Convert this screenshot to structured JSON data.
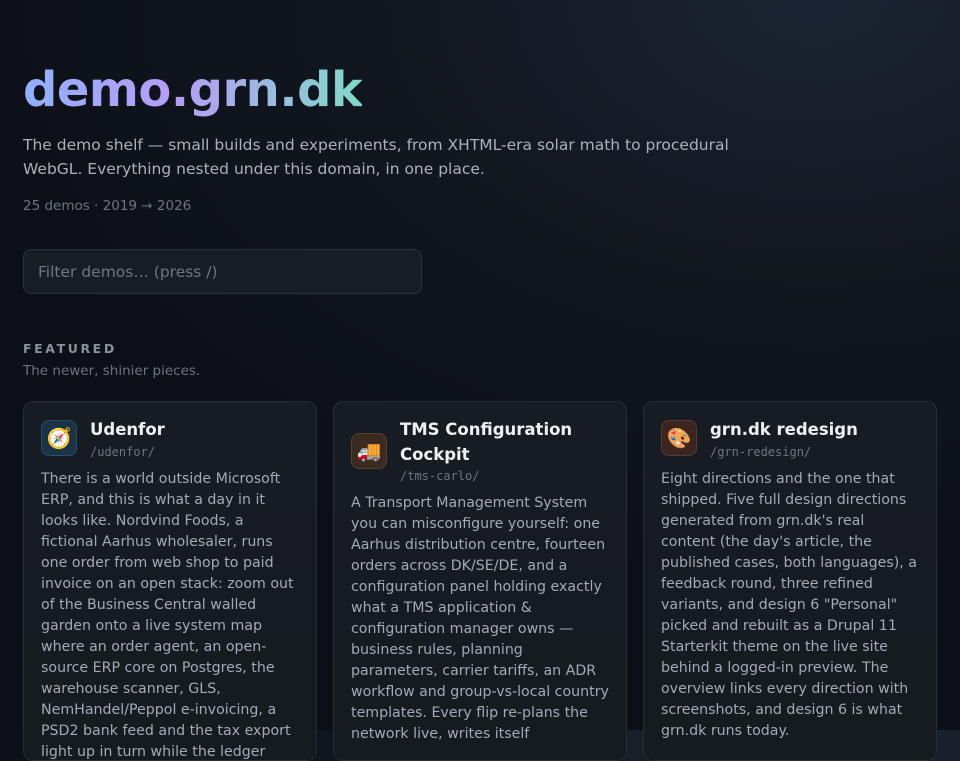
{
  "header": {
    "title": "demo.grn.dk",
    "intro": "The demo shelf — small builds and experiments, from XHTML-era solar math to procedural WebGL. Everything nested under this domain, in one place.",
    "meta": "25 demos · 2019 → 2026"
  },
  "filter": {
    "placeholder": "Filter demos… (press /)"
  },
  "featured": {
    "label": "FEATURED",
    "subtitle": "The newer, shinier pieces.",
    "cards": [
      {
        "icon": "compass-icon",
        "icon_glyph": "🧭",
        "title": "Udenfor",
        "path": "/udenfor/",
        "description": "There is a world outside Microsoft ERP, and this is what a day in it looks like. Nordvind Foods, a fictional Aarhus wholesaler, runs one order from web shop to paid invoice on an open stack: zoom out of the Business Central walled garden onto a live system map where an order agent, an open-source ERP core on Postgres, the warehouse scanner, GLS, NemHandel/Peppol e-invoicing, a PSD2 bank feed and the tax export light up in turn while the ledger posts"
      },
      {
        "icon": "truck-icon",
        "icon_glyph": "🚚",
        "title": "TMS Configuration Cockpit",
        "path": "/tms-carlo/",
        "description": "A Transport Management System you can misconfigure yourself: one Aarhus distribution centre, fourteen orders across DK/SE/DE, and a configuration panel holding exactly what a TMS application & configuration manager owns — business rules, planning parameters, carrier tariffs, an ADR workflow and group-vs-local country templates. Every flip re-plans the network live, writes itself"
      },
      {
        "icon": "palette-icon",
        "icon_glyph": "🎨",
        "title": "grn.dk redesign",
        "path": "/grn-redesign/",
        "description": "Eight directions and the one that shipped. Five full design directions generated from grn.dk's real content (the day's article, the published cases, both languages), a feedback round, three refined variants, and design 6 \"Personal\" picked and rebuilt as a Drupal 11 Starterkit theme on the live site behind a logged-in preview. The overview links every direction with screenshots, and design 6 is what grn.dk runs today."
      }
    ]
  },
  "colors": {
    "title_gradient": [
      "#8fb1ff",
      "#b79cf7",
      "#7fd9c8"
    ],
    "background": "#0f131a"
  }
}
